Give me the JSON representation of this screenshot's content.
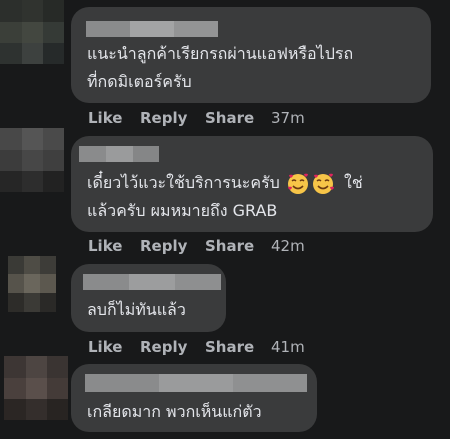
{
  "colors": {
    "background": "#18191a",
    "bubble": "#3a3b3c",
    "text": "#e4e6eb",
    "secondary": "#b0b3b8"
  },
  "comments": [
    {
      "text_lines": [
        "แนะนำลูกค้าเรียกรถผ่านแอฟหรือไปรถ",
        "ที่กดมิเตอร์ครับ"
      ],
      "like": "Like",
      "reply": "Reply",
      "share": "Share",
      "time": "37m"
    },
    {
      "text_lines": [
        "เดี๋ยวไว้แวะใช้บริการนะครับ",
        "แล้วครับ ผมหมายถึง GRAB"
      ],
      "line1_suffix": "ใช่",
      "emoji": "smiling-face-with-hearts-icon",
      "like": "Like",
      "reply": "Reply",
      "share": "Share",
      "time": "42m"
    },
    {
      "text_lines": [
        "ลบก็ไม่ทันแล้ว"
      ],
      "like": "Like",
      "reply": "Reply",
      "share": "Share",
      "time": "41m"
    },
    {
      "text_lines": [
        "เกลียดมาก พวกเห็นแก่ตัว"
      ]
    }
  ]
}
